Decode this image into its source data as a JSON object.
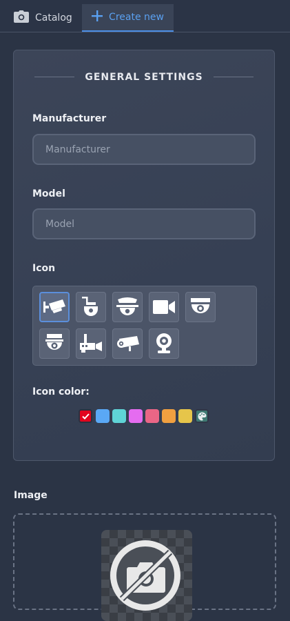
{
  "tabs": {
    "catalog_label": "Catalog",
    "create_label": "Create new"
  },
  "panel": {
    "title": "GENERAL SETTINGS",
    "manufacturer": {
      "label": "Manufacturer",
      "placeholder": "Manufacturer",
      "value": ""
    },
    "model": {
      "label": "Model",
      "placeholder": "Model",
      "value": ""
    },
    "icon": {
      "label": "Icon",
      "options": [
        "bullet-camera-icon",
        "ptz-camera-icon",
        "speed-dome-camera-icon",
        "video-camera-icon",
        "dome-camera-icon",
        "dome-camera-alt-icon",
        "wall-camera-icon",
        "box-camera-icon",
        "webcam-icon"
      ],
      "selected": "bullet-camera-icon"
    },
    "icon_color": {
      "label": "Icon color:",
      "swatches": [
        "#e2051e",
        "#5aa8f5",
        "#5fd3d6",
        "#e56cf0",
        "#ea6686",
        "#f0a040",
        "#e6c54a"
      ],
      "selected": "#e2051e",
      "picker_icon": "palette-icon"
    }
  },
  "image": {
    "label": "Image",
    "placeholder_icon": "no-photo-icon"
  },
  "colors": {
    "accent": "#4b8ee6",
    "background": "#2b3445"
  }
}
